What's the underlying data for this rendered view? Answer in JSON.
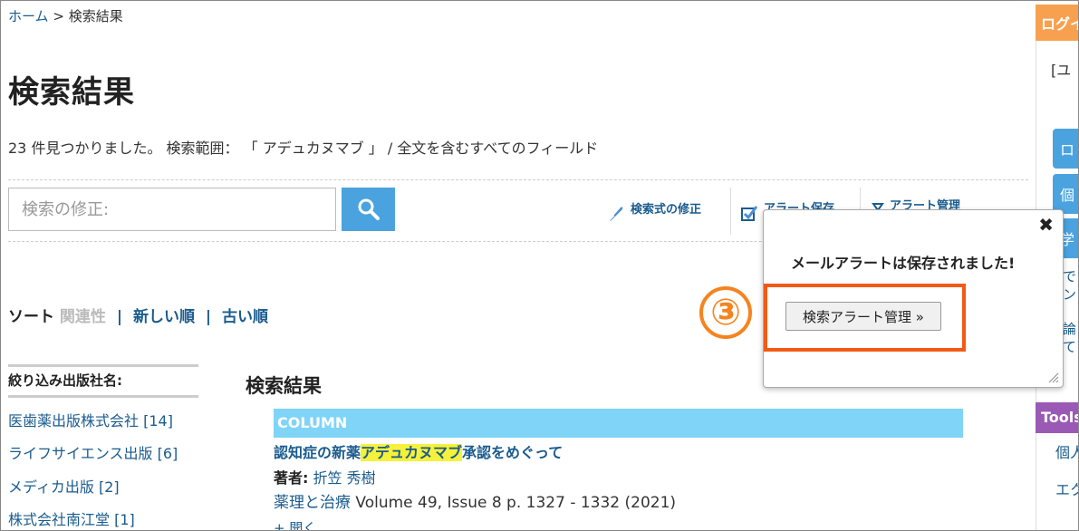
{
  "breadcrumb": {
    "home": "ホーム",
    "separator": ">",
    "current": "検索結果"
  },
  "page_title": "検索結果",
  "summary": "23 件見つかりました。 検索範囲： 「 アデュカヌマブ 」 / 全文を含むすべてのフィールド",
  "search": {
    "placeholder": "検索の修正:"
  },
  "toolbar": {
    "modify_query": "検索式の修正",
    "save_alert": "アラート保存",
    "manage_alert": "アラート管理"
  },
  "sort": {
    "label": "ソート",
    "relevance": "関連性",
    "newest": "新しい順",
    "oldest": "古い順",
    "sep": "|"
  },
  "facets": {
    "title": "絞り込み出版社名:",
    "items": [
      "医歯薬出版株式会社 [14]",
      "ライフサイエンス出版 [6]",
      "メディカ出版 [2]",
      "株式会社南江堂 [1]"
    ]
  },
  "results": {
    "heading": "検索結果",
    "items": [
      {
        "category": "COLUMN",
        "title_before": "認知症の新薬",
        "title_highlight": "アデュカヌマブ",
        "title_after": "承認をめぐって",
        "authors_label": "著者:",
        "authors": "折笠 秀樹",
        "journal": "薬理と治療",
        "citation_rest": " Volume 49, Issue 8 p. 1327 - 1332 (2021)",
        "toggle": "+ 開く"
      }
    ]
  },
  "right_panel": {
    "login": "ログイン",
    "user_stub": "[ユ",
    "btn1": "ロ",
    "btn2": "個",
    "btn3": "学",
    "text1": "で",
    "text2": "ン",
    "text3": "論",
    "text4": "て",
    "tools": "Tools",
    "link1": "個人",
    "link2": "エク"
  },
  "popup": {
    "message": "メールアラートは保存されました!",
    "button": "検索アラート管理 »",
    "close": "✖"
  },
  "annotation": {
    "step": "③"
  },
  "colors": {
    "accent": "#4aa3df",
    "link": "#1a5b8e",
    "column_bar": "#7fd4f7",
    "highlight": "#f6f13a",
    "annotation_box": "#f25a16",
    "annotation_marker": "#f5841f",
    "login_bar": "#f7a150",
    "tools_bar": "#9b59b6"
  }
}
